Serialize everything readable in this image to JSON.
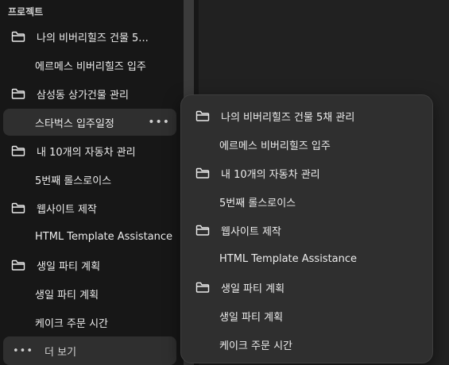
{
  "sidebar": {
    "section_title": "프로젝트",
    "rows": [
      {
        "kind": "project",
        "label": "나의 비버리힐즈 건물 5..."
      },
      {
        "kind": "chat",
        "label": "에르메스 비버리힐즈 입주"
      },
      {
        "kind": "project",
        "label": "삼성동 상가건물 관리"
      },
      {
        "kind": "chat",
        "label": "스타벅스 입주일정",
        "active": true
      },
      {
        "kind": "project",
        "label": "내 10개의 자동차 관리"
      },
      {
        "kind": "chat",
        "label": "5번째 롤스로이스"
      },
      {
        "kind": "project",
        "label": "웹사이트 제작"
      },
      {
        "kind": "chat",
        "label": "HTML Template Assistance"
      },
      {
        "kind": "project",
        "label": "생일 파티 계획"
      },
      {
        "kind": "chat",
        "label": "생일 파티 계획"
      },
      {
        "kind": "chat",
        "label": "케이크 주문 시간"
      }
    ],
    "more_dots": "•••",
    "see_more_dots": "•••",
    "see_more_label": "더 보기"
  },
  "popup": {
    "items": [
      {
        "kind": "project",
        "label": "나의 비버리힐즈 건물 5채 관리"
      },
      {
        "kind": "chat",
        "label": "에르메스 비버리힐즈 입주"
      },
      {
        "kind": "project",
        "label": "내 10개의 자동차 관리"
      },
      {
        "kind": "chat",
        "label": "5번째 롤스로이스"
      },
      {
        "kind": "project",
        "label": "웹사이트 제작"
      },
      {
        "kind": "chat",
        "label": "HTML Template Assistance"
      },
      {
        "kind": "project",
        "label": "생일 파티 계획"
      },
      {
        "kind": "chat",
        "label": "생일 파티 계획"
      },
      {
        "kind": "chat",
        "label": "케이크 주문 시간"
      }
    ]
  },
  "icons": {
    "folder": "folder-icon",
    "more": "more-horizontal-icon"
  },
  "colors": {
    "background": "#171717",
    "panel": "#2f2f2f",
    "main": "#212121",
    "text": "#ececec"
  }
}
